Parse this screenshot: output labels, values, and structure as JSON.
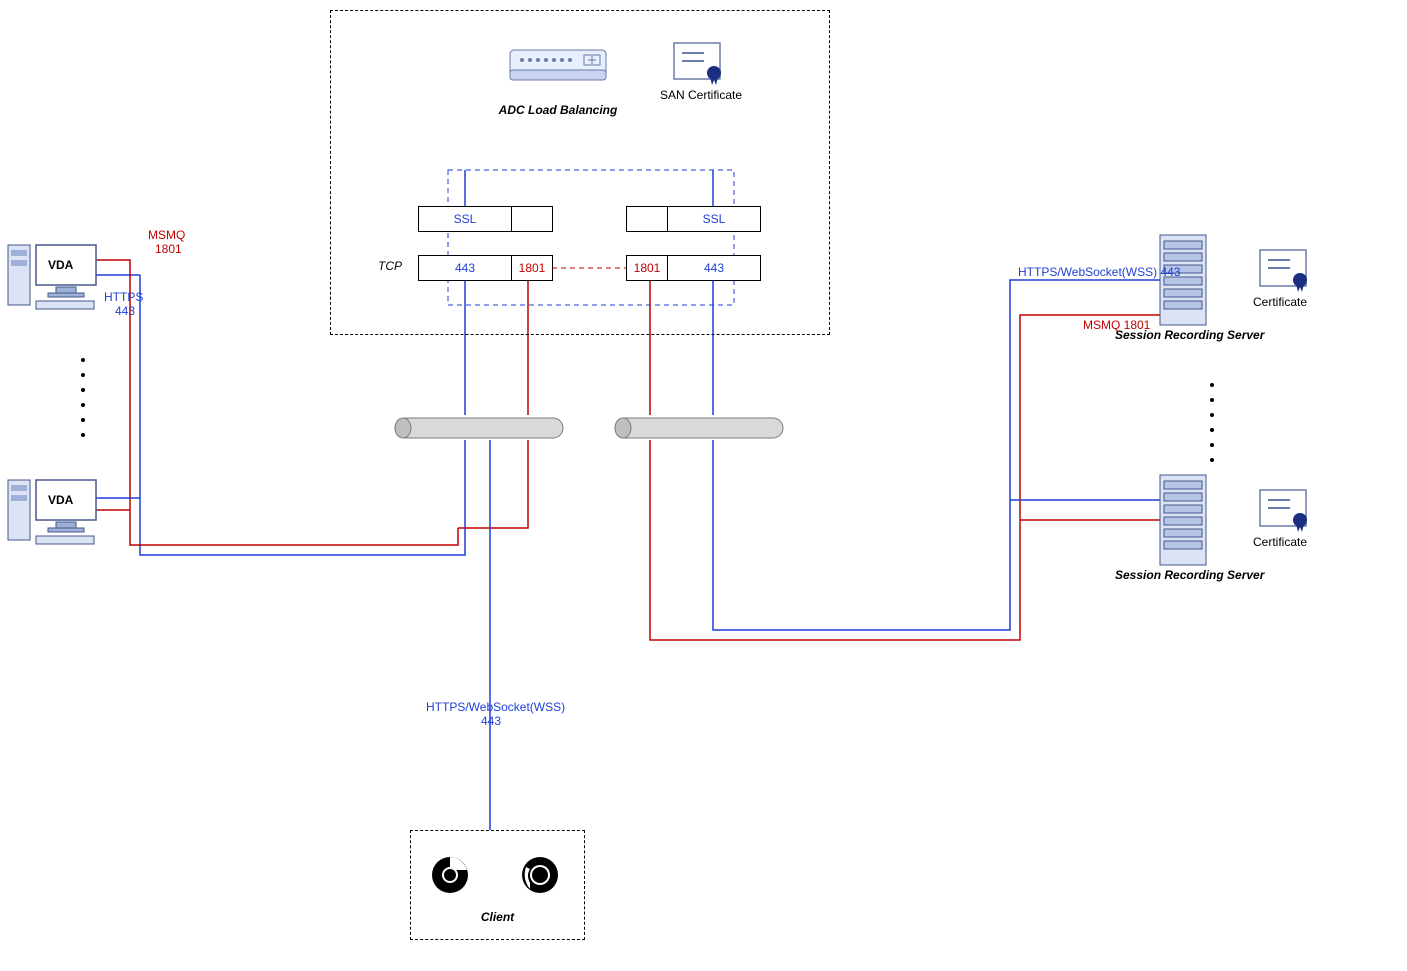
{
  "adc": {
    "title": "ADC Load Balancing",
    "san_cert": "SAN Certificate",
    "tcp_label": "TCP",
    "ssl": "SSL",
    "port443": "443",
    "port1801": "1801"
  },
  "vda": {
    "label": "VDA",
    "msmq": "MSMQ",
    "msmq_port": "1801",
    "https": "HTTPS",
    "https_port": "443"
  },
  "client": {
    "title": "Client",
    "up_label1": "HTTPS/WebSocket(WSS)",
    "up_label2": "443"
  },
  "srs": {
    "title": "Session Recording Server",
    "cert": "Certificate",
    "https_wss": "HTTPS/WebSocket(WSS)  443",
    "msmq": "MSMQ  1801"
  }
}
